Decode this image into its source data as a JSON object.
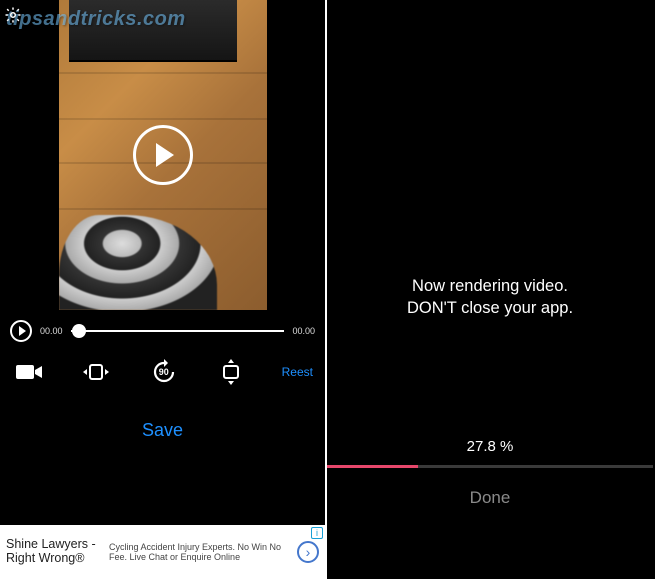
{
  "watermark": "tipsandtricks.com",
  "left": {
    "scrubber": {
      "current_time": "00.00",
      "total_time": "00.00"
    },
    "tools": {
      "camera": "camera-icon",
      "flip": "flip-horizontal-icon",
      "rotate_label": "90",
      "mirror": "flip-vertical-icon"
    },
    "reset_label": "Reest",
    "save_label": "Save",
    "ad": {
      "title": "Shine Lawyers -",
      "title2": "Right Wrong®",
      "subtitle": "",
      "body_line1": "Cycling Accident Injury Experts. No Win No",
      "body_line2": "Fee. Live Chat or Enquire Online",
      "info_badge": "i"
    }
  },
  "right": {
    "message_line1": "Now rendering video.",
    "message_line2": "DON'T close your app.",
    "percent_label": "27.8 %",
    "progress_value": 27.8,
    "done_label": "Done"
  }
}
